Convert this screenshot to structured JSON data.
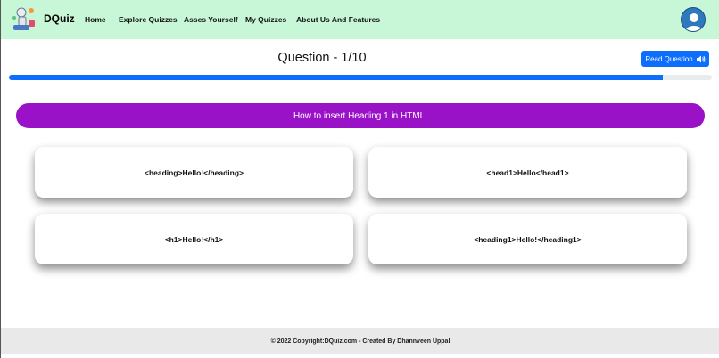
{
  "navbar": {
    "brand": "DQuiz",
    "links": [
      "Home",
      "Explore Quizzes",
      "Asses Yourself",
      "My Quizzes",
      "About Us And Features"
    ],
    "logo_icon": "robot-mascot-icon",
    "avatar_icon": "user-avatar-icon",
    "background": "#c8f7d8"
  },
  "quiz": {
    "title": "Question - 1/10",
    "read_button_label": "Read Question",
    "read_button_icon": "speaker-icon",
    "progress_fraction": 0.93,
    "question": "How to insert Heading 1 in HTML.",
    "options": [
      "<heading>Hello!</heading>",
      "<head1>Hello</head1>",
      "<h1>Hello!</h1>",
      "<heading1>Hello!</heading1>"
    ],
    "accent_color": "#9a12c8",
    "primary_color": "#0d6efd"
  },
  "footer": {
    "text": "© 2022 Copyright:DQuiz.com - Created By Dhannveen Uppal"
  }
}
